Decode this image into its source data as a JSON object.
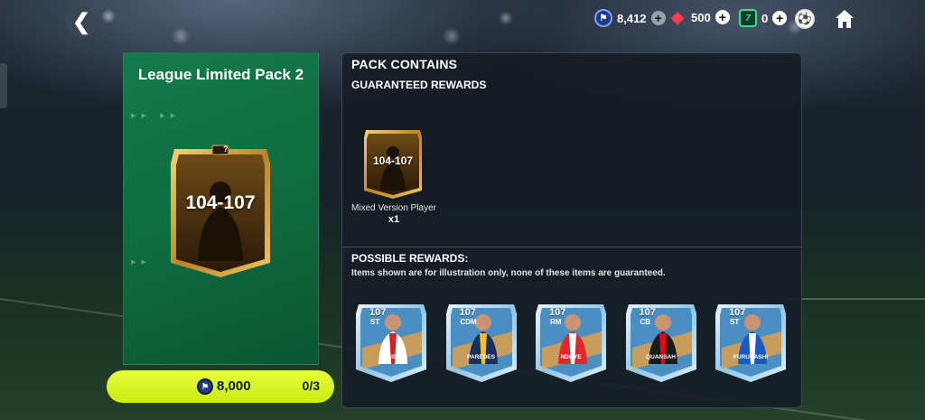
{
  "header": {
    "back_symbol": "❮",
    "currencies": [
      {
        "icon": "fc-points-icon",
        "value": "8,412",
        "color": "#7aa0ff"
      },
      {
        "icon": "gem-icon",
        "value": "500",
        "color": "#ff3b4e"
      },
      {
        "icon": "token-icon",
        "value": "0",
        "color": "#38e08a"
      }
    ],
    "ball_icon": "football-icon",
    "home_icon": "home-icon"
  },
  "pack": {
    "title": "League Limited Pack 2",
    "card_rating": "104-107",
    "card_badge": "?",
    "price": "8,000",
    "purchase_count": "0/3",
    "bg_color": "#147a4a"
  },
  "panel": {
    "heading": "PACK CONTAINS",
    "guaranteed": {
      "heading": "GUARANTEED REWARDS",
      "card_rating": "104-107",
      "label": "Mixed Version Player",
      "quantity": "x1"
    },
    "possible": {
      "heading": "POSSIBLE REWARDS:",
      "note": "Items shown are for illustration only, none of these items are guaranteed.",
      "cards": [
        {
          "rating": "107",
          "position": "ST",
          "name": "COLIDIO",
          "kit": "#ffffff",
          "stripe": "#d4202a"
        },
        {
          "rating": "107",
          "position": "CDM",
          "name": "PAREDES",
          "kit": "#1a2d5c",
          "stripe": "#f2c21b"
        },
        {
          "rating": "107",
          "position": "RM",
          "name": "NDOYE",
          "kit": "#e3262d",
          "stripe": "#ffffff"
        },
        {
          "rating": "107",
          "position": "CB",
          "name": "QUANSAH",
          "kit": "#1a1a1a",
          "stripe": "#e30613"
        },
        {
          "rating": "107",
          "position": "ST",
          "name": "FURUHASHI",
          "kit": "#1659c7",
          "stripe": "#ffffff"
        }
      ]
    }
  }
}
